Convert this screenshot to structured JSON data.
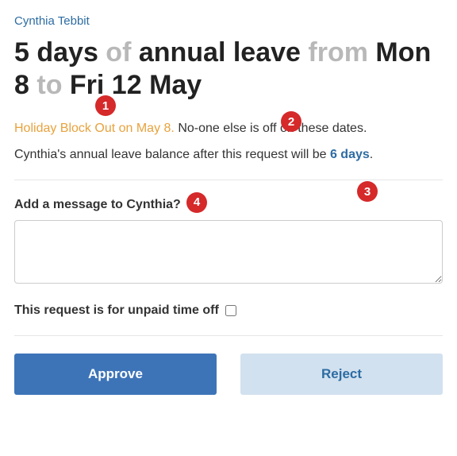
{
  "employee_name": "Cynthia Tebbit",
  "title": {
    "days": "5 days",
    "of": " of ",
    "leave_type": "annual leave",
    "from": " from ",
    "start": "Mon 8",
    "to": " to ",
    "end": "Fri 12 May"
  },
  "holiday_warning": "Holiday Block Out on May 8.",
  "conflict_text": " No-one else is off on these dates.",
  "balance": {
    "prefix": "Cynthia's annual leave balance after this request will be ",
    "days": "6 days",
    "suffix": "."
  },
  "message_label": "Add a message to Cynthia?",
  "unpaid_label": "This request is for unpaid time off",
  "buttons": {
    "approve": "Approve",
    "reject": "Reject"
  },
  "annotations": {
    "a1": "1",
    "a2": "2",
    "a3": "3",
    "a4": "4"
  }
}
